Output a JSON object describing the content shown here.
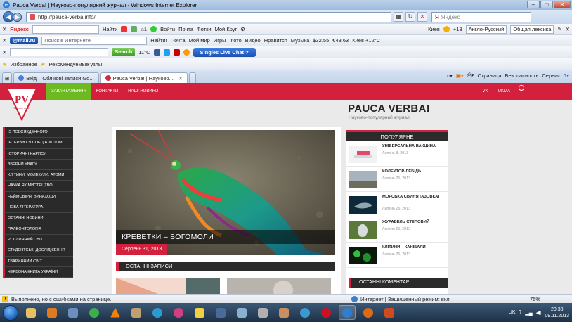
{
  "window": {
    "title": "Pauca Verba! | Науково-популярний журнал - Windows Internet Explorer"
  },
  "address": {
    "url": "http://pauca-verba.info/",
    "search_placeholder": "Яндекс"
  },
  "toolbars": {
    "yandex": {
      "brand": "Яндекс",
      "find": "Найти",
      "login": "Войти",
      "mail": "Почта",
      "photos": "Фотки",
      "mycircle": "Мой Круг",
      "city": "Киев",
      "weather": "+13",
      "translate_lang": "Англо-Русский",
      "dict": "Общая лексика"
    },
    "mailru": {
      "brand": "@mail.ru",
      "search_placeholder": "Поиск в Интернете",
      "find": "Найти!",
      "mail": "Почта",
      "myworld": "Мой мир",
      "games": "Игры",
      "photo": "Фото",
      "video": "Видео",
      "like": "Нравится",
      "music": "Музыка",
      "usd": "$32.55",
      "eur": "€43.63",
      "kyiv_weather": "Киев +12°C"
    },
    "third": {
      "search_button": "Search",
      "temperature": "11°C",
      "live_chat": "Singles Live Chat ?"
    },
    "favorites": {
      "label": "Избранное",
      "recommended": "Рекомендуемые узлы"
    }
  },
  "tabs": [
    {
      "label": "Вхід – Облікові записи Go..."
    },
    {
      "label": "Pauca Verba! | Науково..."
    }
  ],
  "command_bar": {
    "page": "Страница",
    "security": "Безопасность",
    "service": "Сервис"
  },
  "site": {
    "logo_text": "PV",
    "logo_sub": "Science & art",
    "title": "PAUCA VERBA!",
    "subtitle": "Науково-популярний журнал",
    "nav": [
      "ЗАВАНТАЖЕННЯ",
      "КОНТАКТИ",
      "НАШІ НОВИНИ"
    ],
    "nav_right": [
      "VK",
      "UKMA"
    ],
    "left_menu": [
      "ІЗ ПОВСЯКДЕННОГО",
      "ІНТЕРВ'Ю ЗІ СПЕЦІАЛІСТОМ",
      "ІСТОРИЧНІ НАРИСИ",
      "ЗВЕРНИ УВАГУ",
      "КЛІТИНИ, МОЛЕКУЛИ, АТОМИ",
      "НАУКА ЯК МИСТЕЦТВО",
      "НЕЙМОВІРНІ ВИНАХОДИ",
      "НОВА ЛІТЕРАТУРА",
      "ОСТАННІ НОВИНИ",
      "ПАЛЕОНТОЛОГІЯ",
      "РОСЛИННИЙ СВІТ",
      "СТУДЕНТСЬКІ ДОСЛІДЖЕННЯ",
      "ТВАРИННИЙ СВІТ",
      "ЧЕРВОНА КНИГА УКРАЇНИ"
    ],
    "hero": {
      "caption": "КРЕВЕТКИ – БОГОМОЛИ",
      "date": "Серпень 31, 2013"
    },
    "latest_heading": "ОСТАННІ ЗАПИСИ",
    "popular_heading": "ПОПУЛЯРНЕ",
    "popular": [
      {
        "title": "УНІВЕРСАЛЬНА ВАКЦИНА",
        "date": "Липень 8, 2013"
      },
      {
        "title": "КОЛЕКТОР-ЛЕБІДЬ",
        "date": "Липень 25, 2013"
      },
      {
        "title": "МОРСЬКА СВИНЯ (АЗОВКА)",
        "date": "Липень 25, 2013"
      },
      {
        "title": "ЖУРАВЕЛЬ СТЕПОВИЙ",
        "date": "Липень 25, 2013"
      },
      {
        "title": "КЛІТИНИ – КАНІБАЛИ",
        "date": "Липень 25, 2013"
      }
    ],
    "comments_heading": "ОСТАННІ КОМЕНТАРІ"
  },
  "status": {
    "text": "Выполнено, но с ошибками на странице.",
    "security": "Интернет | Защищенный режим: вкл.",
    "zoom": "75%"
  },
  "taskbar": {
    "lang": "UK",
    "time": "20:38",
    "date": "09.11.2013"
  },
  "colors": {
    "brand_red": "#d3203c",
    "nav_active": "#6cba1f",
    "menu_dark": "#2a2a2a"
  }
}
